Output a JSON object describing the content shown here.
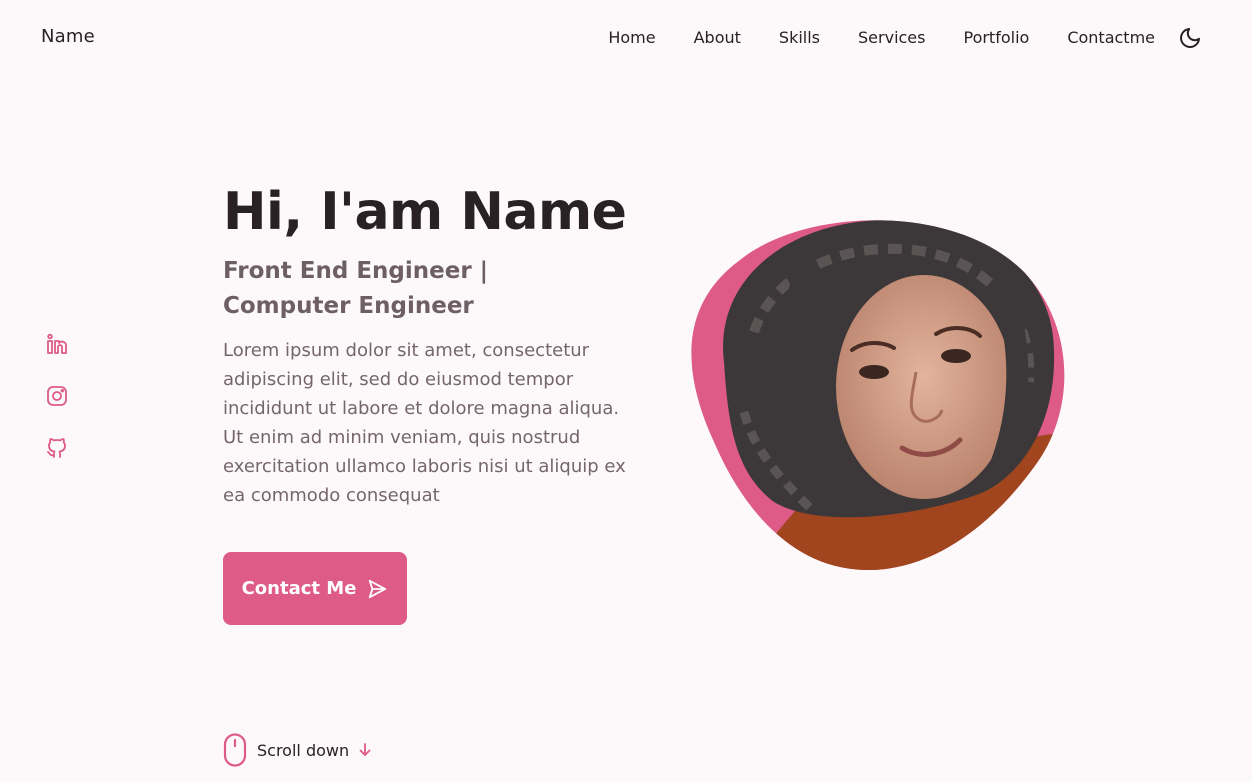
{
  "header": {
    "brand": "Name",
    "nav": [
      {
        "label": "Home"
      },
      {
        "label": "About"
      },
      {
        "label": "Skills"
      },
      {
        "label": "Services"
      },
      {
        "label": "Portfolio"
      },
      {
        "label": "Contactme"
      }
    ],
    "theme_toggle_icon": "moon-icon"
  },
  "social": [
    {
      "icon": "linkedin-icon"
    },
    {
      "icon": "instagram-icon"
    },
    {
      "icon": "github-icon"
    }
  ],
  "hero": {
    "title": "Hi, I'am Name",
    "subtitle": "Front End Engineer | Computer Engineer",
    "description": "Lorem ipsum dolor sit amet, consectetur adipiscing elit, sed do eiusmod tempor incididunt ut labore et dolore magna aliqua. Ut enim ad minim veniam, quis nostrud exercitation ullamco laboris nisi ut aliquip ex ea commodo consequat",
    "button_label": "Contact Me",
    "button_icon": "send-icon",
    "image": "profile-photo"
  },
  "scroll": {
    "label": "Scroll down",
    "icon": "mouse-icon",
    "arrow_icon": "arrow-down-icon"
  },
  "colors": {
    "accent": "#de5a87",
    "background": "#fdf9fa",
    "text": "#2a2124",
    "muted_text": "#75666b"
  }
}
